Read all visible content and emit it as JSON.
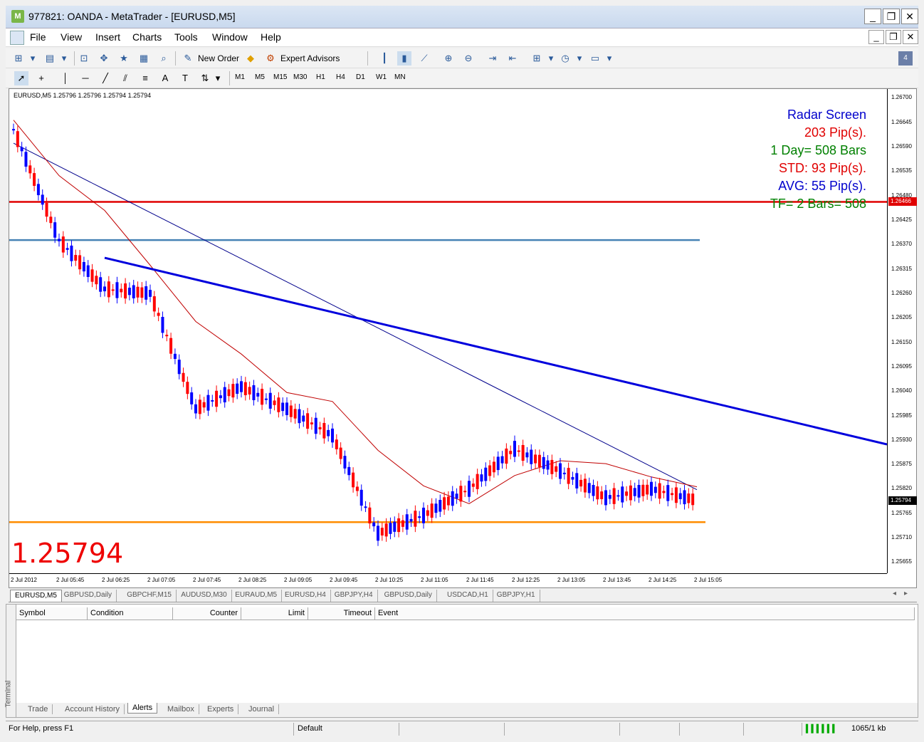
{
  "window": {
    "title": "977821: OANDA - MetaTrader - [EURUSD,M5]"
  },
  "menu": [
    "File",
    "View",
    "Insert",
    "Charts",
    "Tools",
    "Window",
    "Help"
  ],
  "toolbar": {
    "new_order": "New Order",
    "expert_advisors": "Expert Advisors",
    "badge": "4"
  },
  "timeframes": [
    "M1",
    "M5",
    "M15",
    "M30",
    "H1",
    "H4",
    "D1",
    "W1",
    "MN"
  ],
  "chart": {
    "header": "EURUSD,M5  1.25796 1.25796 1.25794 1.25794",
    "big_price": "1.25794",
    "radar": [
      {
        "text": "Radar Screen",
        "color": "#0000cc"
      },
      {
        "text": "203 Pip(s).",
        "color": "#e00000"
      },
      {
        "text": "1 Day= 508 Bars",
        "color": "#008000"
      },
      {
        "text": "STD: 93 Pip(s).",
        "color": "#e00000"
      },
      {
        "text": "AVG: 55 Pip(s).",
        "color": "#0000cc"
      },
      {
        "text": "TF= 2 Bars= 508",
        "color": "#008000"
      }
    ],
    "price_labels": [
      "1.26700",
      "1.26645",
      "1.26590",
      "1.26535",
      "1.26480",
      "1.26425",
      "1.26370",
      "1.26315",
      "1.26260",
      "1.26205",
      "1.26150",
      "1.26095",
      "1.26040",
      "1.25985",
      "1.25930",
      "1.25875",
      "1.25820",
      "1.25765",
      "1.25710",
      "1.25655"
    ],
    "red_line_label": "1.26466",
    "current_label": "1.25794",
    "time_labels": [
      "2 Jul 2012",
      "2 Jul 05:45",
      "2 Jul 06:25",
      "2 Jul 07:05",
      "2 Jul 07:45",
      "2 Jul 08:25",
      "2 Jul 09:05",
      "2 Jul 09:45",
      "2 Jul 10:25",
      "2 Jul 11:05",
      "2 Jul 11:45",
      "2 Jul 12:25",
      "2 Jul 13:05",
      "2 Jul 13:45",
      "2 Jul 14:25",
      "2 Jul 15:05"
    ],
    "colors": {
      "bull": "#0000ff",
      "bear": "#ff0000",
      "red_line": "#e00000",
      "orange_line": "#ff8c00",
      "steel_line": "#4682b4",
      "trend": "#0000dd",
      "ma_blue": "#00008b",
      "ma_red": "#c00000"
    }
  },
  "chart_data": {
    "type": "line",
    "title": "EURUSD,M5",
    "ylim": [
      1.2563,
      1.2672
    ],
    "close_series": {
      "name": "EURUSD",
      "x": [
        "2 Jul 2012",
        "2 Jul 05:45",
        "2 Jul 06:25",
        "2 Jul 07:05",
        "2 Jul 07:45",
        "2 Jul 08:25",
        "2 Jul 09:05",
        "2 Jul 09:45",
        "2 Jul 10:25",
        "2 Jul 11:05",
        "2 Jul 11:45",
        "2 Jul 12:25",
        "2 Jul 13:05",
        "2 Jul 13:45",
        "2 Jul 14:25",
        "2 Jul 15:05"
      ],
      "values": [
        1.2663,
        1.2638,
        1.2627,
        1.2626,
        1.26,
        1.2605,
        1.26,
        1.2594,
        1.2572,
        1.2576,
        1.2582,
        1.2591,
        1.2586,
        1.258,
        1.2582,
        1.25794
      ]
    },
    "horizontal_levels": [
      1.26466,
      1.2638,
      1.25745
    ],
    "trendline": {
      "start": [
        "2 Jul 06:25",
        1.2634
      ],
      "end": [
        "2 Jul 15:05",
        1.2592
      ]
    }
  },
  "chart_tabs": [
    "EURUSD,M5",
    "GBPUSD,Daily",
    "GBPCHF,M15",
    "AUDUSD,M30",
    "EURAUD,M5",
    "EURUSD,H4",
    "GBPJPY,H4",
    "GBPUSD,Daily",
    "USDCAD,H1",
    "GBPJPY,H1"
  ],
  "terminal": {
    "label": "Terminal",
    "columns": [
      "Symbol",
      "Condition",
      "Counter",
      "Limit",
      "Timeout",
      "Event"
    ],
    "tabs": [
      "Trade",
      "Account History",
      "Alerts",
      "Mailbox",
      "Experts",
      "Journal"
    ]
  },
  "status": {
    "help": "For Help, press F1",
    "profile": "Default",
    "traffic": "1065/1 kb"
  }
}
